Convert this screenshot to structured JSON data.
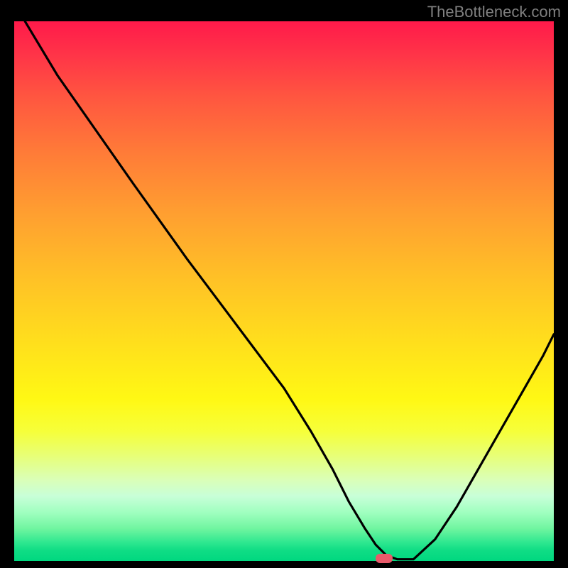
{
  "watermark": "TheBottleneck.com",
  "chart_data": {
    "type": "line",
    "title": "",
    "xlabel": "",
    "ylabel": "",
    "xlim": [
      0,
      100
    ],
    "ylim": [
      0,
      100
    ],
    "series": [
      {
        "name": "curve",
        "x": [
          2,
          8,
          15,
          22,
          27,
          32,
          38,
          44,
          50,
          55,
          59,
          62,
          65,
          67,
          69,
          71,
          74,
          78,
          82,
          86,
          90,
          94,
          98,
          100
        ],
        "y": [
          100,
          90,
          80,
          70,
          63,
          56,
          48,
          40,
          32,
          24,
          17,
          11,
          6,
          3,
          1,
          0.3,
          0.3,
          4,
          10,
          17,
          24,
          31,
          38,
          42
        ]
      }
    ],
    "marker": {
      "cx": 68.5,
      "cy": 0.5
    },
    "gradient_description": "vertical gradient red (top) to green (bottom), yellow mid",
    "background": "#000000"
  }
}
